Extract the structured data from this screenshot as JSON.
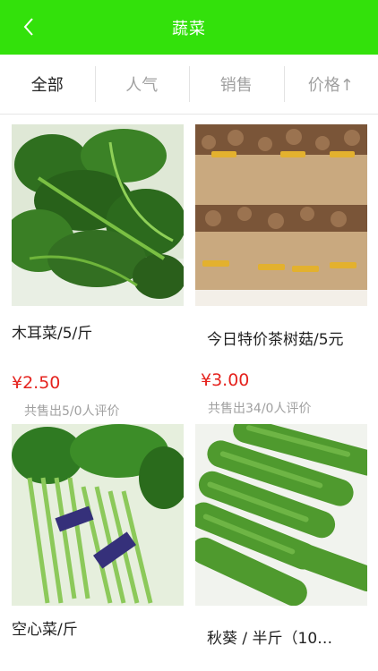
{
  "header": {
    "title": "蔬菜"
  },
  "tabs": [
    {
      "label": "全部",
      "active": true
    },
    {
      "label": "人气",
      "active": false
    },
    {
      "label": "销售",
      "active": false
    },
    {
      "label": "价格↑",
      "active": false
    }
  ],
  "products": [
    {
      "name": "木耳菜/5/斤",
      "price": "¥2.50",
      "sold": "共售出5/0人评价",
      "image": "malabar-spinach-image"
    },
    {
      "name": "今日特价茶树菇/5元",
      "price": "¥3.00",
      "sold": "共售出34/0人评价",
      "image": "tea-tree-mushroom-image"
    },
    {
      "name": "空心菜/斤",
      "image": "water-spinach-image"
    },
    {
      "name": "秋葵 / 半斤（10…",
      "image": "okra-image"
    }
  ],
  "colors": {
    "header_bg": "#33e10b",
    "price": "#e5231e",
    "muted": "#a0a0a0"
  }
}
